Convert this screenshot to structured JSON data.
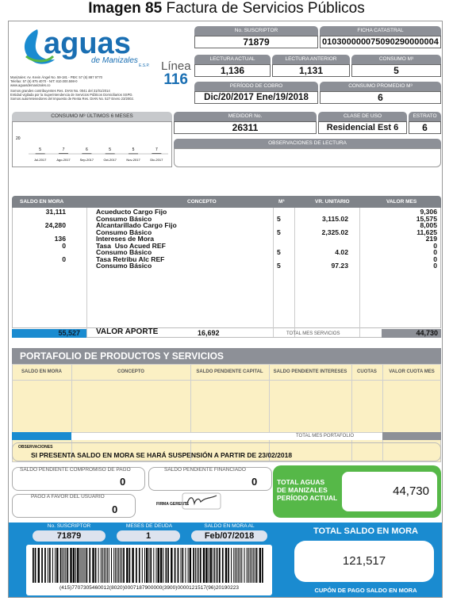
{
  "caption": {
    "bold": "Imagen 85",
    "rest": " Factura de Servicios Públicos"
  },
  "brand": {
    "name": "aguas",
    "sub": "de Manizales",
    "tag": "E.S.P."
  },
  "linea": {
    "label": "Línea",
    "number": "116"
  },
  "company_info": [
    "Manizales: Av. Kevin Ángel No. 59-181 - PBX: 57 (6) 887 9770",
    "Telefax: 57 (6) 875 4070 - NIT: 810.000.598-0",
    "www.aguasdemanizales.co",
    "Somos grandes contribuyentes Res. DIAN No. 0041 del 31/01/2014",
    "Entidad vigilada por la Superintendencia de Servicios Públicos Domiciliarios SSPD.",
    "Somos autorretenedores del Impuesto de Renta Res. DIAN No. 527 Enero 23/2002."
  ],
  "fields": {
    "suscriptor_label": "No. SUSCRIPTOR",
    "suscriptor": "71879",
    "ficha_label": "FICHA CATASTRAL",
    "ficha": "010300000075090290000004",
    "lect_actual_label": "LECTURA ACTUAL",
    "lect_actual": "1,136",
    "lect_anterior_label": "LECTURA ANTERIOR",
    "lect_anterior": "1,131",
    "consumo_label": "CONSUMO M³",
    "consumo": "5",
    "periodo_label": "PERÍODO DE COBRO",
    "periodo": "Dic/20/2017  Ene/19/2018",
    "promedio_label": "CONSUMO PROMEDIO M³",
    "promedio": "6",
    "medidor_label": "MEDIDOR No.",
    "medidor": "26311",
    "clase_label": "CLASE DE USO",
    "clase": "Residencial Est 6",
    "estrato_label": "ESTRATO",
    "estrato": "6",
    "observ_lectura_label": "OBSERVACIONES DE LECTURA"
  },
  "consumo_chart": {
    "title": "CONSUMO M³ ÚLTIMOS 6 MESES",
    "chart_data": {
      "type": "bar",
      "title": "CONSUMO M³ ÚLTIMOS 6 MESES",
      "categories": [
        "Jul-2017",
        "Ago-2017",
        "Sep-2017",
        "Oct-2017",
        "Nov-2017",
        "Dic-2017"
      ],
      "values": [
        5,
        7,
        6,
        5,
        5,
        7
      ],
      "y_tick": "20"
    }
  },
  "table": {
    "headers": [
      "SALDO EN MORA",
      "CONCEPTO",
      "M³",
      "VR. UNITARIO",
      "VALOR MES"
    ],
    "saldo_col": "31,111\n\n24,280\n\n136\n0\n\n0",
    "concepto_col": "Acueducto Cargo Fijo\nConsumo Básico\nAlcantarillado Cargo Fijo\nConsumo Básico\nIntereses de Mora\nTasa  Uso Acued REF\nConsumo Básico\nTasa Retribu Alc REF\nConsumo Básico",
    "m3_col": "\n5\n\n5\n\n\n5\n\n5",
    "unit_col": "\n3,115.02\n\n2,325.02\n\n\n4.02\n\n97.23",
    "valor_col": "9,306\n15,575\n8,005\n11,625\n219\n0\n0\n0\n0",
    "footer_saldo": "55,527",
    "footer_aporte_label": "VALOR APORTE",
    "footer_aporte": "16,692",
    "footer_total_label": "TOTAL MES SERVICIOS",
    "footer_total": "44,730"
  },
  "portafolio": {
    "title": "PORTAFOLIO DE PRODUCTOS Y SERVICIOS",
    "headers": [
      "SALDO EN MORA",
      "CONCEPTO",
      "SALDO PENDIENTE CAPITAL",
      "SALDO PENDIENTE INTERESES",
      "CUOTAS",
      "VALOR CUOTA MES"
    ],
    "total_label": "TOTAL MES PORTAFOLIO"
  },
  "observaciones": {
    "label": "OBSERVACIONES",
    "text": "SI PRESENTA SALDO EN MORA SE HARÁ SUSPENSIÓN A PARTIR DE 23/02/2018"
  },
  "compromiso": {
    "label": "SALDO PENDIENTE COMPROMISO DE PAGO",
    "value": "0"
  },
  "financiado": {
    "label": "SALDO PENDIENTE FINANCIADO",
    "value": "0"
  },
  "a_favor": {
    "label": "PAGO A FAVOR DEL USUARIO",
    "value": "0"
  },
  "firma_label": "FIRMA GERENTE",
  "total_aguas": {
    "label": "TOTAL AGUAS\nDE MANIZALES\nPERÍODO ACTUAL",
    "value": "44,730"
  },
  "cupon": {
    "suscriptor_label": "No. SUSCRIPTOR",
    "suscriptor": "71879",
    "meses_label": "MESES DE DEUDA",
    "meses": "1",
    "saldo_al_label": "SALDO EN MORA AL",
    "saldo_al": "Feb/07/2018",
    "barcode_text": "(415)7707305460012(8020)0007187900000(3900)0000121517(96)20190223",
    "total_mora_label": "TOTAL SALDO EN MORA",
    "total_mora": "121,517",
    "cupon_label": "CUPÓN DE PAGO SALDO EN MORA"
  },
  "colors": {
    "blue": "#1a8bd0",
    "gray": "#8d9097",
    "green": "#56b848",
    "cream": "#fbf0c4"
  }
}
